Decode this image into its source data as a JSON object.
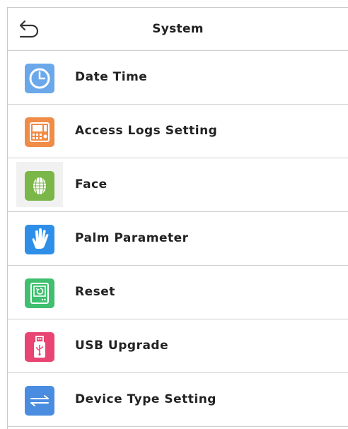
{
  "header": {
    "title": "System",
    "back_icon": "back-arrow-icon"
  },
  "menu": {
    "items": [
      {
        "label": "Date Time",
        "icon": "clock-icon",
        "color": "#6aa8ea"
      },
      {
        "label": "Access Logs Setting",
        "icon": "attendance-terminal-icon",
        "color": "#f08c47"
      },
      {
        "label": "Face",
        "icon": "face-icon",
        "color": "#7ab648"
      },
      {
        "label": "Palm Parameter",
        "icon": "palm-icon",
        "color": "#2f8fe8"
      },
      {
        "label": "Reset",
        "icon": "reset-icon",
        "color": "#3fbf6f"
      },
      {
        "label": "USB Upgrade",
        "icon": "usb-icon",
        "color": "#e84572"
      },
      {
        "label": "Device Type Setting",
        "icon": "swap-arrows-icon",
        "color": "#4a8de0"
      }
    ]
  }
}
